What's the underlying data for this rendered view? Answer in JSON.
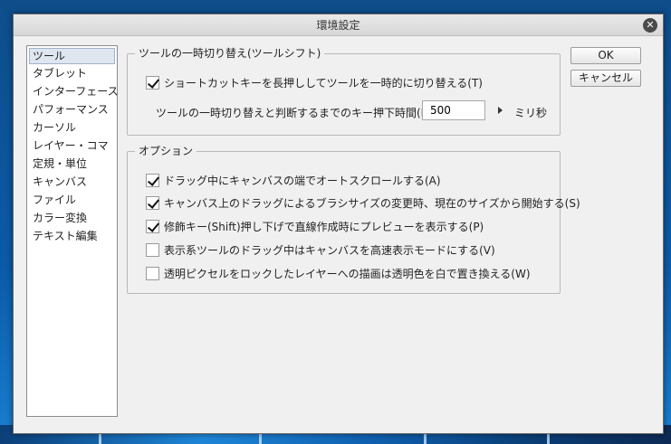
{
  "window": {
    "title": "環境設定",
    "close_glyph": "✕"
  },
  "nav": {
    "items": [
      {
        "label": "ツール",
        "selected": true
      },
      {
        "label": "タブレット"
      },
      {
        "label": "インターフェース"
      },
      {
        "label": "パフォーマンス"
      },
      {
        "label": "カーソル"
      },
      {
        "label": "レイヤー・コマ"
      },
      {
        "label": "定規・単位"
      },
      {
        "label": "キャンバス"
      },
      {
        "label": "ファイル"
      },
      {
        "label": "カラー変換"
      },
      {
        "label": "テキスト編集"
      }
    ]
  },
  "tool_shift": {
    "legend": "ツールの一時切り替え(ツールシフト)",
    "checkbox_label": "ショートカットキーを長押ししてツールを一時的に切り替える(T)",
    "checked": true,
    "time_label": "ツールの一時切り替えと判断するまでのキー押下時間(K):",
    "time_value": "500",
    "unit": "ミリ秒"
  },
  "options": {
    "legend": "オプション",
    "items": [
      {
        "label": "ドラッグ中にキャンバスの端でオートスクロールする(A)",
        "checked": true
      },
      {
        "label": "キャンバス上のドラッグによるブラシサイズの変更時、現在のサイズから開始する(S)",
        "checked": true
      },
      {
        "label": "修飾キー(Shift)押し下げで直線作成時にプレビューを表示する(P)",
        "checked": true
      },
      {
        "label": "表示系ツールのドラッグ中はキャンバスを高速表示モードにする(V)",
        "checked": false
      },
      {
        "label": "透明ピクセルをロックしたレイヤーへの描画は透明色を白で置き換える(W)",
        "checked": false
      }
    ]
  },
  "buttons": {
    "ok": "OK",
    "cancel": "キャンセル"
  },
  "icons": {
    "close": "close-icon",
    "arrow": "triangle-right-icon",
    "check": "checkmark-icon"
  }
}
